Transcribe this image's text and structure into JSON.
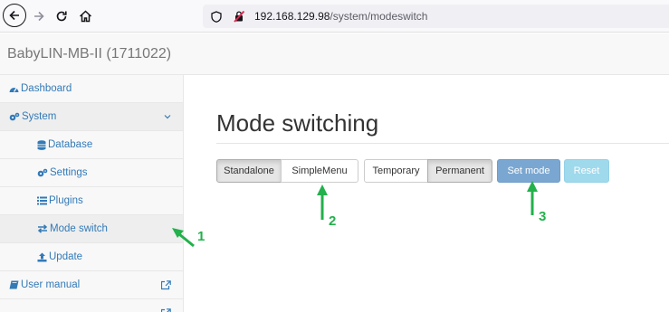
{
  "browser": {
    "url_host": "192.168.129.98",
    "url_path": "/system/modeswitch"
  },
  "app": {
    "brand": "BabyLIN-MB-II (1711022)"
  },
  "sidebar": {
    "items": [
      {
        "label": "Dashboard",
        "icon": "dashboard-icon"
      },
      {
        "label": "System",
        "icon": "cogs-icon"
      },
      {
        "label": "Database",
        "icon": "database-icon"
      },
      {
        "label": "Settings",
        "icon": "cogs-icon"
      },
      {
        "label": "Plugins",
        "icon": "list-icon"
      },
      {
        "label": "Mode switch",
        "icon": "exchange-icon"
      },
      {
        "label": "Update",
        "icon": "upload-icon"
      },
      {
        "label": "User manual",
        "icon": "book-icon"
      }
    ]
  },
  "main": {
    "title": "Mode switching",
    "mode_buttons": [
      "Standalone",
      "SimpleMenu"
    ],
    "persist_buttons": [
      "Temporary",
      "Permanent"
    ],
    "set_mode_label": "Set mode",
    "reset_label": "Reset"
  },
  "annotations": {
    "labels": [
      "1",
      "2",
      "3"
    ],
    "color": "#22b14c"
  },
  "colors": {
    "link": "#337ab7",
    "primary_disabled": "#7aa7d1",
    "info_disabled": "#9fd9ec"
  }
}
